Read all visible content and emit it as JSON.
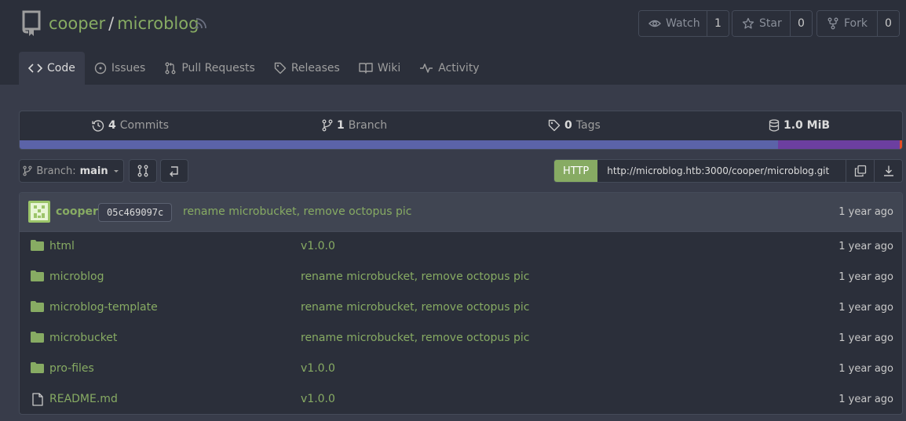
{
  "repo": {
    "owner": "cooper",
    "separator": "/",
    "name": "microblog"
  },
  "actions": {
    "watch": {
      "label": "Watch",
      "count": "1"
    },
    "star": {
      "label": "Star",
      "count": "0"
    },
    "fork": {
      "label": "Fork",
      "count": "0"
    }
  },
  "tabs": [
    {
      "label": "Code",
      "icon": "code-icon"
    },
    {
      "label": "Issues",
      "icon": "issue-icon"
    },
    {
      "label": "Pull Requests",
      "icon": "pull-request-icon"
    },
    {
      "label": "Releases",
      "icon": "tag-icon"
    },
    {
      "label": "Wiki",
      "icon": "book-icon"
    },
    {
      "label": "Activity",
      "icon": "pulse-icon"
    }
  ],
  "stats": {
    "commits": {
      "count": "4",
      "label": "Commits"
    },
    "branches": {
      "count": "1",
      "label": "Branch"
    },
    "tags": {
      "count": "0",
      "label": "Tags"
    },
    "size": {
      "value": "1.0 MiB"
    }
  },
  "languages": [
    {
      "color": "#5b63a8",
      "share": 0.859
    },
    {
      "color": "#6c3fa0",
      "share": 0.138
    },
    {
      "color": "#e34c26",
      "share": 0.003
    }
  ],
  "toolbar": {
    "branch_prefix": "Branch:",
    "branch_name": "main"
  },
  "clone": {
    "protocol": "HTTP",
    "url": "http://microblog.htb:3000/cooper/microblog.git"
  },
  "latest_commit": {
    "author": "cooper",
    "sha": "05c469097c",
    "message": "rename microbucket, remove octopus pic",
    "age": "1 year ago"
  },
  "files": [
    {
      "name": "html",
      "type": "folder",
      "message": "v1.0.0",
      "age": "1 year ago"
    },
    {
      "name": "microblog",
      "type": "folder",
      "message": "rename microbucket, remove octopus pic",
      "age": "1 year ago"
    },
    {
      "name": "microblog-template",
      "type": "folder",
      "message": "rename microbucket, remove octopus pic",
      "age": "1 year ago"
    },
    {
      "name": "microbucket",
      "type": "folder",
      "message": "rename microbucket, remove octopus pic",
      "age": "1 year ago"
    },
    {
      "name": "pro-files",
      "type": "folder",
      "message": "v1.0.0",
      "age": "1 year ago"
    },
    {
      "name": "README.md",
      "type": "file",
      "message": "v1.0.0",
      "age": "1 year ago"
    }
  ],
  "colors": {
    "accent": "#87ab63",
    "header_bg": "#2b2f3a",
    "page_bg": "#383c4a"
  }
}
